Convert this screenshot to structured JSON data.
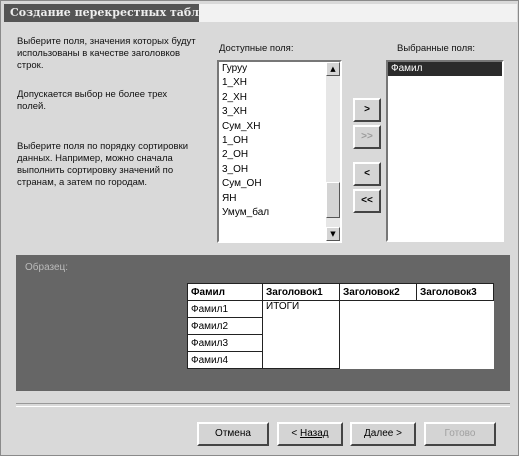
{
  "window": {
    "title": "Создание перекрестных таблиц"
  },
  "instructions": {
    "p1": "Выберите поля, значения которых будут использованы в качестве заголовков строк.",
    "p2": "Допускается выбор не более трех полей.",
    "p3": "Выберите поля по порядку сортировки данных. Например, можно сначала выполнить сортировку значений по странам, а затем по городам."
  },
  "available": {
    "label": "Доступные поля:",
    "items": [
      "Гуруу",
      "1_ХН",
      "2_ХН",
      "3_ХН",
      "Сум_ХН",
      "1_ОН",
      "2_ОН",
      "3_ОН",
      "Сум_ОН",
      "ЯН",
      "Умум_бал"
    ]
  },
  "selected": {
    "label": "Выбранные поля:",
    "items": [
      "Фамил"
    ]
  },
  "move_buttons": {
    "add": ">",
    "add_all": ">>",
    "remove": "<",
    "remove_all": "<<"
  },
  "sample": {
    "label": "Образец:",
    "corner": "Фамил",
    "columns": [
      "Заголовок1",
      "Заголовок2",
      "Заголовок3"
    ],
    "rows": [
      "Фамил1",
      "Фамил2",
      "Фамил3",
      "Фамил4"
    ],
    "cell": "ИТОГИ"
  },
  "buttons": {
    "cancel": "Отмена",
    "back_prefix": "< ",
    "back": "Назад",
    "next": "Далее >",
    "finish": "Готово"
  }
}
